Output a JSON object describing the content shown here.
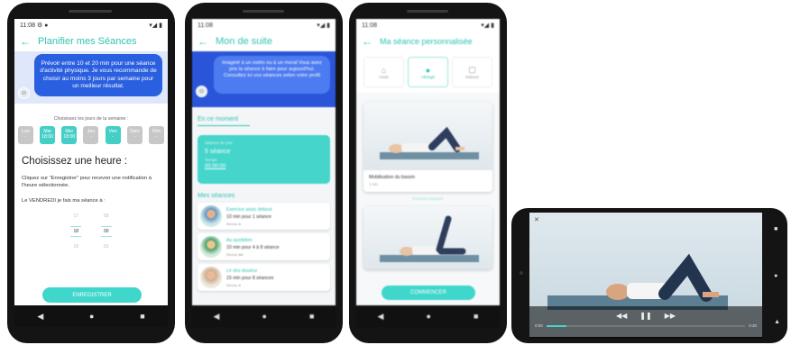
{
  "colors": {
    "teal": "#2fc4b2",
    "blue": "#2a5fe0",
    "chip_on": "#44cfc6",
    "chip_off": "#c7c7c7",
    "button": "#3fd6cc"
  },
  "screen1": {
    "status_time": "11:08",
    "status_icons_left": "⚙ ●",
    "status_icons_right": "▾◢ ▮",
    "title": "Planifier mes Séances",
    "bubble_text": "Prévoir entre 10 et 20 min pour une séance d'activité physique. Je vous recommande de choisir au moins 3 jours par semaine pour un meilleur résultat.",
    "days_prompt": "Choisissez les jours de la semaine :",
    "days": [
      {
        "day": "Lun",
        "time": "-",
        "active": false
      },
      {
        "day": "Mar",
        "time": "18:00",
        "active": true
      },
      {
        "day": "Mer",
        "time": "18:00",
        "active": true
      },
      {
        "day": "Jeu",
        "time": "-",
        "active": false
      },
      {
        "day": "Ven",
        "time": "-",
        "active": true
      },
      {
        "day": "Sam",
        "time": "-",
        "active": false
      },
      {
        "day": "Dim",
        "time": "-",
        "active": false
      }
    ],
    "heading": "Choisissez une heure :",
    "instructions": "Cliquez sur \"Enregistrer\" pour recevoir une notification à l'heure sélectionnée.",
    "day_sentence": "Le VENDREDI je fais ma séance à :",
    "picker": {
      "hours": [
        "17",
        "18",
        "19"
      ],
      "minutes": [
        "59",
        "00",
        "01"
      ]
    },
    "save_label": "ENREGISTRER"
  },
  "screen2": {
    "title": "Mon de suite",
    "bubble_text": "Imaginé à un ostéo ou à un moral Vous avez pris la séance à faire pour aujourd'hui. Consultez ici vos séances selon votre profil",
    "tab_label": "En ce moment",
    "card": {
      "label": "Séance du jour",
      "line1": "5 séance",
      "line2": "Temps",
      "line3": "00:00:00"
    },
    "section_label": "Mes séances",
    "items": [
      {
        "title": "Exercice assis debout",
        "line1": "10 min pour 1 séance",
        "line2": "Niveau ●"
      },
      {
        "title": "Au quotidien",
        "line1": "10 min pour 4 à 8 séance",
        "line2": "Niveau ●●"
      },
      {
        "title": "Le dos douleur",
        "line1": "15 min pour 8 séances",
        "line2": "Niveau ●"
      }
    ]
  },
  "screen3": {
    "title": "Ma séance personnalisée",
    "tabs": [
      "Assis",
      "Allongé",
      "Debout"
    ],
    "exercise1": {
      "name": "Mobilisation du bassin",
      "meta": "1 min"
    },
    "next_label": "Exercice suivant",
    "start_label": "COMMENCER"
  },
  "screen4": {
    "time_start": "0:00",
    "time_end": "0:30",
    "close_glyph": "✕"
  },
  "nav": {
    "back": "◀",
    "home": "●",
    "recent": "■"
  }
}
